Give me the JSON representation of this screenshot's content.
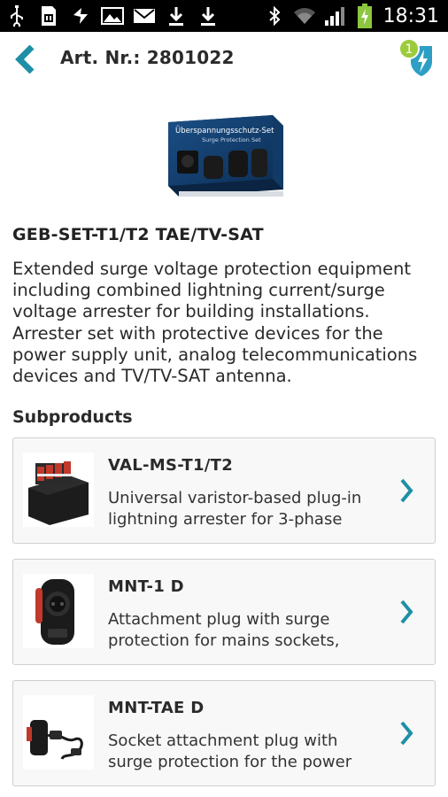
{
  "status_bar": {
    "time": "18:31",
    "battery_color": "#8dc63f"
  },
  "header": {
    "title": "Art. Nr.: 2801022",
    "notification_count": "1",
    "accent_color": "#1e8fa6"
  },
  "product": {
    "image_text": "Überspannungsschutz-Set",
    "image_subtext": "Surge Protection Set",
    "name": "GEB-SET-T1/T2 TAE/TV-SAT",
    "description_lines": [
      "Extended surge voltage protection equipment",
      "including combined lightning current/surge",
      "voltage arrester for building installations.",
      "Arrester set with protective devices for the",
      "power supply unit, analog telecommunications",
      "devices and TV/TV-SAT antenna."
    ]
  },
  "subproducts": {
    "title": "Subproducts",
    "items": [
      {
        "name": "VAL-MS-T1/T2",
        "desc_line1": "Universal varistor-based plug-in",
        "desc_line2": "lightning arrester for 3-phase"
      },
      {
        "name": "MNT-1 D",
        "desc_line1": "Attachment plug with surge",
        "desc_line2": "protection for mains sockets,"
      },
      {
        "name": "MNT-TAE D",
        "desc_line1": "Socket attachment plug with",
        "desc_line2": "surge protection for the power"
      }
    ]
  }
}
